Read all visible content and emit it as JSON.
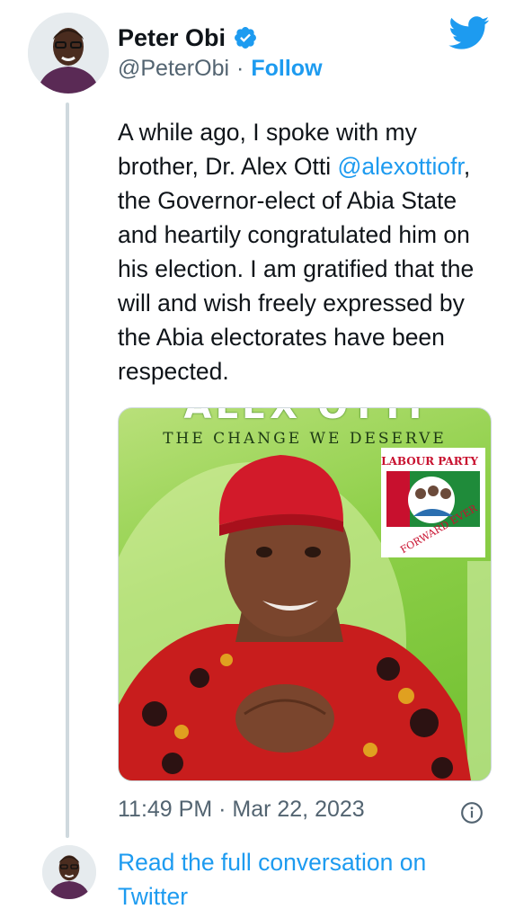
{
  "author": {
    "display_name": "Peter Obi",
    "handle": "@PeterObi",
    "separator": "·",
    "follow_label": "Follow"
  },
  "tweet": {
    "text_part1": "A while ago, I spoke with my brother, Dr. Alex Otti ",
    "mention": "@alexottiofr",
    "text_part2": ", the Governor-elect of Abia State and heartily congratulated him on his election. I am gratified that the will and wish freely expressed by the Abia electorates have been respected.",
    "timestamp": "11:49 PM · Mar 22, 2023"
  },
  "media": {
    "poster_name": "ALEX OTTI",
    "slogan": "THE CHANGE WE DESERVE",
    "party_label": "LABOUR PARTY",
    "party_motto": "FORWARD EVER"
  },
  "footer": {
    "read_full_label": "Read the full conversation on Twitter"
  },
  "colors": {
    "accent": "#1d9bf0",
    "text": "#0f1419",
    "muted": "#536471",
    "thread_line": "#cfd9de"
  },
  "icons": {
    "verified": "verified-badge-icon",
    "brand": "twitter-bird-icon",
    "info": "info-icon"
  }
}
